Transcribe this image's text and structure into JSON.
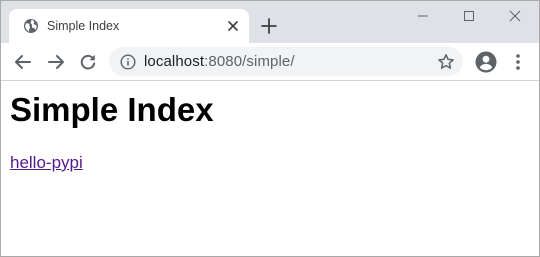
{
  "browser": {
    "tab": {
      "title": "Simple Index",
      "favicon": "globe-icon",
      "close_icon": "close-icon"
    },
    "new_tab_icon": "plus-icon",
    "window_controls": [
      "minimize-icon",
      "maximize-icon",
      "close-icon"
    ],
    "toolbar": {
      "back_icon": "arrow-left-icon",
      "forward_icon": "arrow-right-icon",
      "reload_icon": "reload-icon",
      "site_info_icon": "info-icon",
      "url_host": "localhost",
      "url_rest": ":8080/simple/",
      "bookmark_icon": "star-icon",
      "profile_icon": "account-circle-icon",
      "menu_icon": "kebab-menu-icon"
    }
  },
  "page": {
    "heading": "Simple Index",
    "links": [
      "hello-pypi"
    ],
    "link_color": "#551a8b"
  },
  "colors": {
    "tabstrip": "#dee1e6",
    "omnibox": "#f1f3f4",
    "icon": "#5f6368"
  }
}
